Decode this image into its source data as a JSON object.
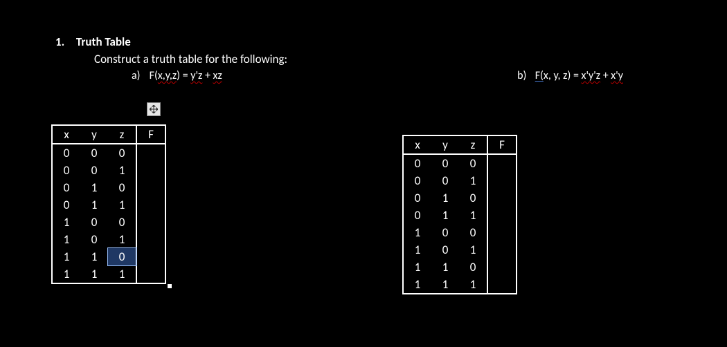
{
  "question": {
    "number": "1.",
    "title": "Truth Table",
    "prompt": "Construct a truth table for the following:"
  },
  "parts": {
    "a": {
      "label": "a)",
      "func_left": "F(",
      "func_args": "x,y,z",
      "func_mid": ") = ",
      "term1": "y'z",
      "plus": " + ",
      "term2": "xz"
    },
    "b": {
      "label": "b)",
      "func_leftU": "F(",
      "func_rest": "x, y, z) = ",
      "term1": "x'y'z",
      "plus": " + ",
      "term2": "x'y"
    }
  },
  "headers": {
    "x": "x",
    "y": "y",
    "z": "z",
    "F": "F"
  },
  "tableA": [
    [
      "0",
      "0",
      "0",
      ""
    ],
    [
      "0",
      "0",
      "1",
      ""
    ],
    [
      "0",
      "1",
      "0",
      ""
    ],
    [
      "0",
      "1",
      "1",
      ""
    ],
    [
      "1",
      "0",
      "0",
      ""
    ],
    [
      "1",
      "0",
      "1",
      ""
    ],
    [
      "1",
      "1",
      "0",
      ""
    ],
    [
      "1",
      "1",
      "1",
      ""
    ]
  ],
  "tableA_selected": {
    "row": 6,
    "col": 2
  },
  "tableB": [
    [
      "0",
      "0",
      "0",
      ""
    ],
    [
      "0",
      "0",
      "1",
      ""
    ],
    [
      "0",
      "1",
      "0",
      ""
    ],
    [
      "0",
      "1",
      "1",
      ""
    ],
    [
      "1",
      "0",
      "0",
      ""
    ],
    [
      "1",
      "0",
      "1",
      ""
    ],
    [
      "1",
      "1",
      "0",
      ""
    ],
    [
      "1",
      "1",
      "1",
      ""
    ]
  ],
  "chart_data": {
    "type": "table",
    "tables": [
      {
        "name": "Truth Table (a) F(x,y,z)=y'z+xz",
        "columns": [
          "x",
          "y",
          "z",
          "F"
        ],
        "rows": [
          [
            "0",
            "0",
            "0",
            null
          ],
          [
            "0",
            "0",
            "1",
            null
          ],
          [
            "0",
            "1",
            "0",
            null
          ],
          [
            "0",
            "1",
            "1",
            null
          ],
          [
            "1",
            "0",
            "0",
            null
          ],
          [
            "1",
            "0",
            "1",
            null
          ],
          [
            "1",
            "1",
            "0",
            null
          ],
          [
            "1",
            "1",
            "1",
            null
          ]
        ]
      },
      {
        "name": "Truth Table (b) F(x,y,z)=x'y'z+x'y",
        "columns": [
          "x",
          "y",
          "z",
          "F"
        ],
        "rows": [
          [
            "0",
            "0",
            "0",
            null
          ],
          [
            "0",
            "0",
            "1",
            null
          ],
          [
            "0",
            "1",
            "0",
            null
          ],
          [
            "0",
            "1",
            "1",
            null
          ],
          [
            "1",
            "0",
            "0",
            null
          ],
          [
            "1",
            "0",
            "1",
            null
          ],
          [
            "1",
            "1",
            "0",
            null
          ],
          [
            "1",
            "1",
            "1",
            null
          ]
        ]
      }
    ]
  }
}
